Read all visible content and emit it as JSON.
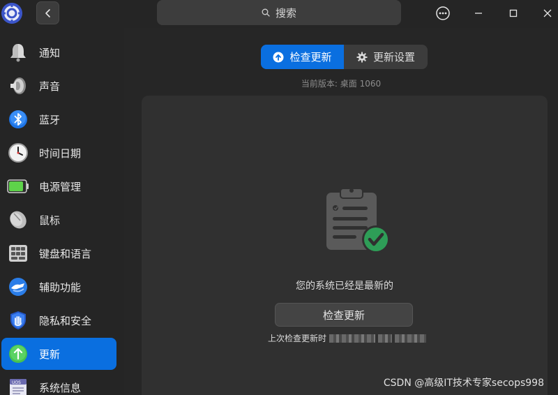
{
  "titlebar": {
    "search_placeholder": "搜索"
  },
  "sidebar": {
    "items": [
      {
        "label": "通知",
        "icon": "bell-icon"
      },
      {
        "label": "声音",
        "icon": "speaker-icon"
      },
      {
        "label": "蓝牙",
        "icon": "bluetooth-icon"
      },
      {
        "label": "时间日期",
        "icon": "clock-icon"
      },
      {
        "label": "电源管理",
        "icon": "battery-icon"
      },
      {
        "label": "鼠标",
        "icon": "mouse-icon"
      },
      {
        "label": "键盘和语言",
        "icon": "keyboard-icon"
      },
      {
        "label": "辅助功能",
        "icon": "accessibility-icon"
      },
      {
        "label": "隐私和安全",
        "icon": "privacy-shield-icon"
      },
      {
        "label": "更新",
        "icon": "update-arrow-icon",
        "active": true
      },
      {
        "label": "系统信息",
        "icon": "system-info-icon"
      }
    ]
  },
  "main": {
    "tabs": [
      {
        "label": "检查更新",
        "icon": "upload-circle-icon",
        "selected": true
      },
      {
        "label": "更新设置",
        "icon": "gear-icon",
        "selected": false
      }
    ],
    "version_text": "当前版本: 桌面 1060",
    "status_text": "您的系统已经是最新的",
    "check_button_label": "检查更新",
    "last_check_label": "上次检查更新时"
  },
  "watermark": "CSDN @高级IT技术专家secops998",
  "colors": {
    "accent": "#0a6fe0",
    "success": "#2e9d57",
    "background": "#262626",
    "panel": "#303030"
  }
}
